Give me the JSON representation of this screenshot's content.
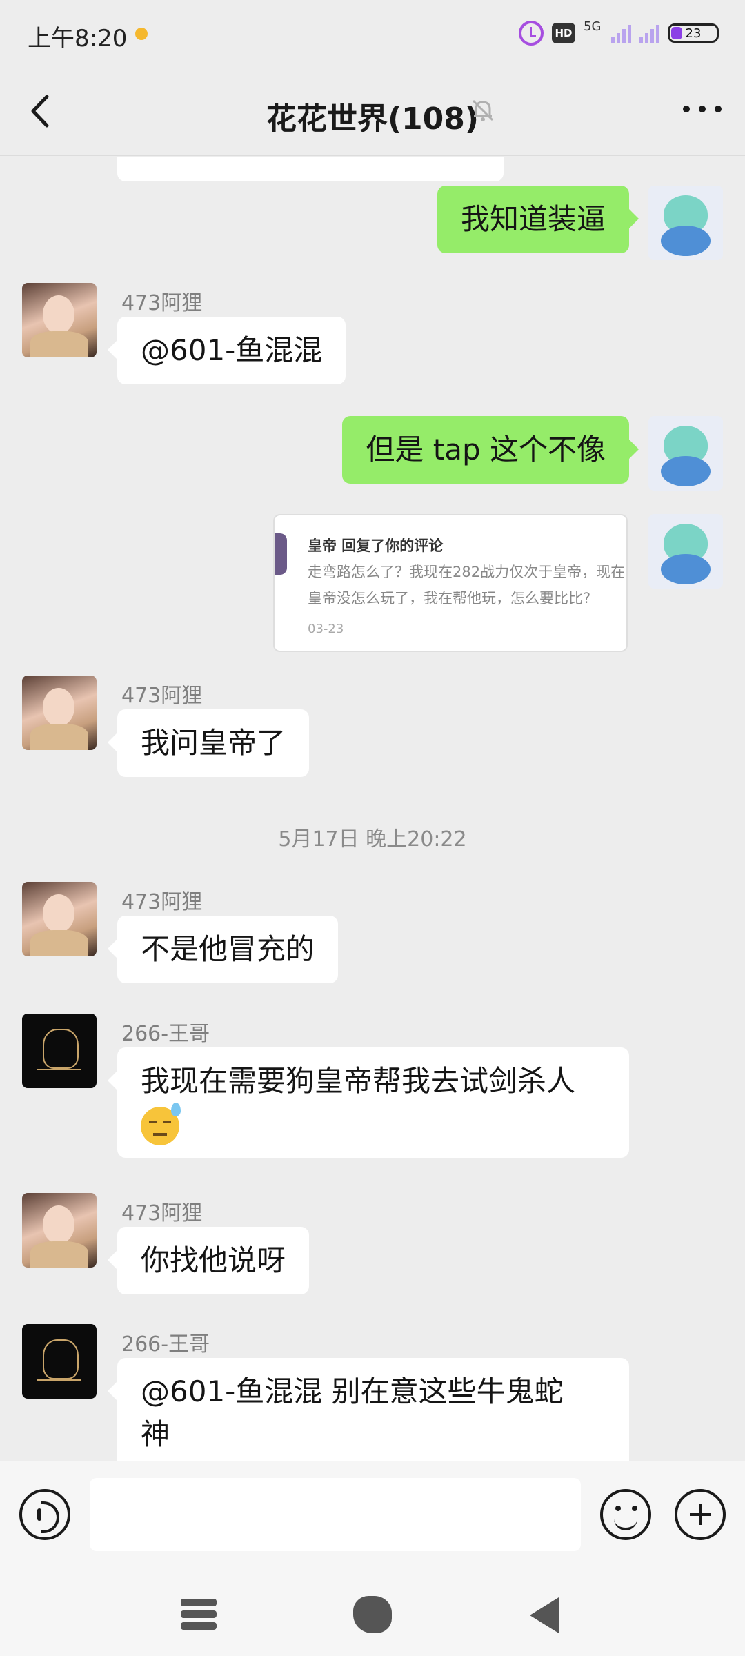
{
  "status_bar": {
    "time": "上午8:20",
    "hd_label": "HD",
    "network_label": "5G",
    "battery_level": "23",
    "icons": [
      "alarm-icon",
      "hd-icon",
      "signal-icon",
      "battery-icon"
    ]
  },
  "header": {
    "title": "花花世界(108)",
    "back_icon": "chevron-left-icon",
    "mute_icon": "bell-off-icon",
    "more_icon": "more-horizontal-icon"
  },
  "messages": [
    {
      "side": "right",
      "text": "我知道装逼"
    },
    {
      "side": "left",
      "sender": "473阿狸",
      "text": "@601-鱼混混"
    },
    {
      "side": "right",
      "text": "但是 tap 这个不像"
    },
    {
      "side": "right",
      "type": "card",
      "card": {
        "title": "皇帝 回复了你的评论",
        "line1": "走弯路怎么了？我现在282战力仅次于皇帝，现在",
        "line2": "皇帝没怎么玩了，我在帮他玩，怎么要比比?",
        "date": "03-23"
      }
    },
    {
      "side": "left",
      "sender": "473阿狸",
      "text": "我问皇帝了"
    },
    {
      "type": "timestamp",
      "text": "5月17日 晚上20:22"
    },
    {
      "side": "left",
      "sender": "473阿狸",
      "text": "不是他冒充的"
    },
    {
      "side": "left",
      "sender": "266-王哥",
      "text": "我现在需要狗皇帝帮我去试剑杀人",
      "emoji": "sweat-emoji"
    },
    {
      "side": "left",
      "sender": "473阿狸",
      "text": "你找他说呀"
    },
    {
      "side": "left",
      "sender": "266-王哥",
      "text_line1": "@601-鱼混混  别在意这些牛鬼蛇",
      "text_line2": "神"
    }
  ],
  "input_bar": {
    "placeholder": "",
    "icons": [
      "voice-icon",
      "emoji-icon",
      "plus-icon"
    ]
  },
  "nav_bar": {
    "icons": [
      "menu-icon",
      "home-icon",
      "back-icon"
    ]
  },
  "colors": {
    "background": "#ededed",
    "my_bubble": "#95ec69",
    "other_bubble": "#ffffff",
    "sender_name": "#7f7f7f",
    "battery_fill": "#8b3fe6"
  }
}
